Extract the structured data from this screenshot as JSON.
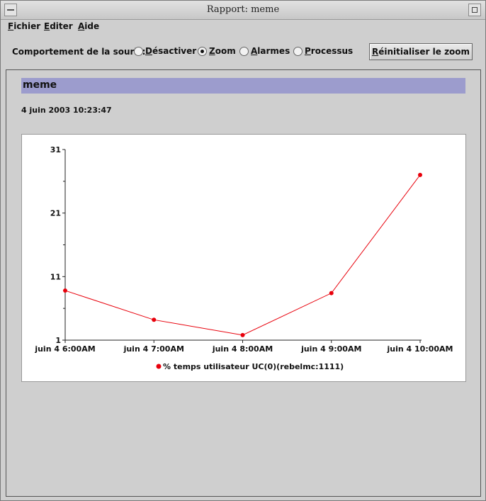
{
  "window": {
    "title": "Rapport: meme"
  },
  "menubar": {
    "items": [
      {
        "mnemonic": "F",
        "rest": "ichier"
      },
      {
        "mnemonic": "E",
        "rest": "diter"
      },
      {
        "mnemonic": "A",
        "rest": "ide"
      }
    ]
  },
  "toolbar": {
    "mouse_behavior_label": "Comportement de la souris:",
    "mouse_modes": [
      {
        "pre": "",
        "mnemonic": "D",
        "post": "ésactiver",
        "selected": false
      },
      {
        "pre": "",
        "mnemonic": "Z",
        "post": "oom",
        "selected": true
      },
      {
        "pre": "",
        "mnemonic": "A",
        "post": "larmes",
        "selected": false
      },
      {
        "pre": "",
        "mnemonic": "P",
        "post": "rocessus",
        "selected": false
      }
    ],
    "reset_zoom": {
      "mnemonic": "R",
      "rest": "éinitialiser le zoom"
    }
  },
  "report": {
    "name": "meme",
    "date": "4 juin 2003 10:23:47"
  },
  "colors": {
    "header_band": "#9c9ccd",
    "series": "#e8000b"
  },
  "chart_data": {
    "type": "line",
    "categories": [
      "juin 4 6:00AM",
      "juin 4 7:00AM",
      "juin 4 8:00AM",
      "juin 4 9:00AM",
      "juin 4 10:00AM"
    ],
    "yticks": [
      1,
      11,
      21,
      31
    ],
    "ylim": [
      1,
      31
    ],
    "series": [
      {
        "name": "% temps utilisateur UC(0)(rebelmc:1111)",
        "values": [
          8.8,
          4.2,
          1.8,
          8.4,
          27
        ]
      }
    ],
    "legend": "bottom",
    "grid": false
  }
}
